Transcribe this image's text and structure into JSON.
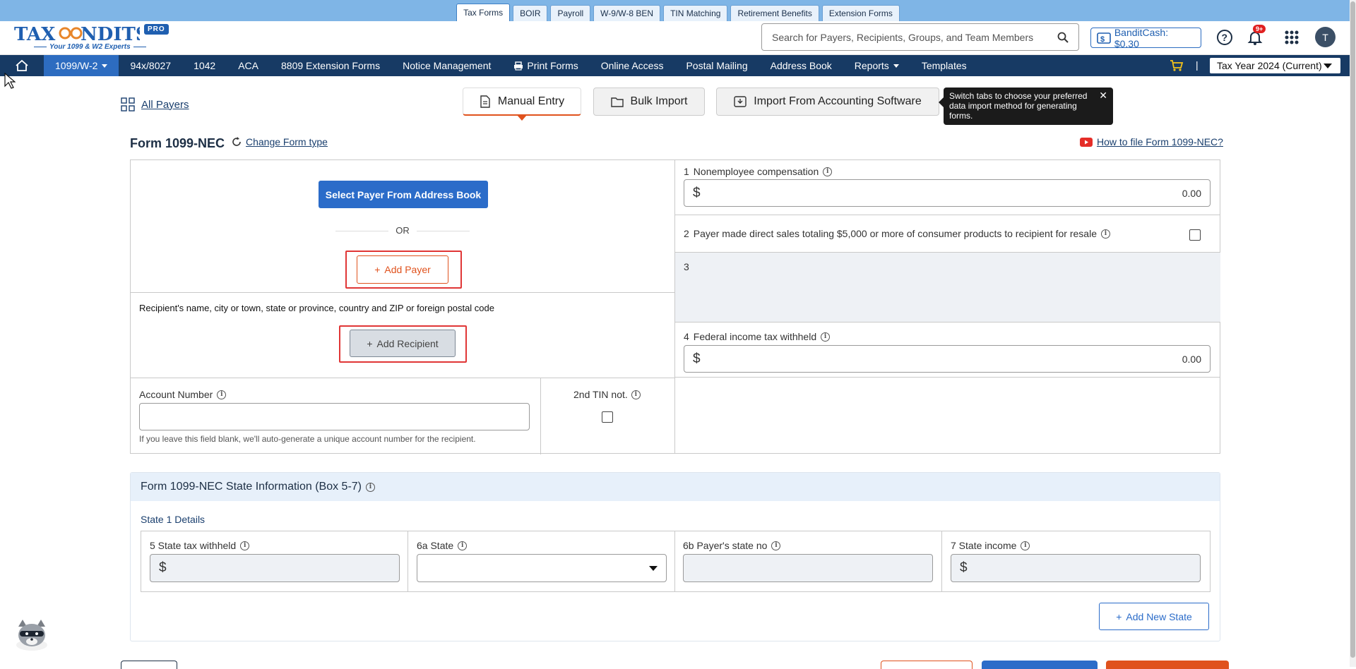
{
  "top_tabs": [
    "Tax Forms",
    "BOIR",
    "Payroll",
    "W-9/W-8 BEN",
    "TIN Matching",
    "Retirement Benefits",
    "Extension Forms"
  ],
  "logo": {
    "text": "TAXBANDITS",
    "registered": "®",
    "tagline": "Your 1099 & W2 Experts",
    "badge": "PRO"
  },
  "header": {
    "search_placeholder": "Search for Payers, Recipients, Groups, and Team Members",
    "bandit_cash": "BanditCash: $0.30",
    "notification_count": "9+",
    "avatar_initial": "T"
  },
  "nav": {
    "items": [
      "1099/W-2",
      "94x/8027",
      "1042",
      "ACA",
      "8809 Extension Forms",
      "Notice Management",
      "Print Forms",
      "Online Access",
      "Postal Mailing",
      "Address Book",
      "Reports",
      "Templates"
    ],
    "tax_year": "Tax Year 2024 (Current)"
  },
  "all_payers": "All Payers",
  "mode_tabs": [
    "Manual Entry",
    "Bulk Import",
    "Import From Accounting Software"
  ],
  "tooltip": "Switch tabs to choose your preferred data import method for generating forms.",
  "form": {
    "title": "Form 1099-NEC",
    "change_type": "Change Form type",
    "how_to": "How to file Form 1099-NEC?",
    "select_payer": "Select Payer From Address Book",
    "or": "OR",
    "add_payer": "Add Payer",
    "recipient_label": "Recipient's name, city or town, state or province, country and ZIP or foreign postal code",
    "add_recipient": "Add Recipient",
    "account_label": "Account Number",
    "account_help": "If you leave this field blank, we'll auto-generate a unique account number for the recipient.",
    "tin_label": "2nd TIN not.",
    "box1_num": "1",
    "box1_label": "Nonemployee compensation",
    "box1_value": "0.00",
    "box2_num": "2",
    "box2_label": "Payer made direct sales totaling $5,000 or more of consumer products to recipient for resale",
    "box3_num": "3",
    "box4_num": "4",
    "box4_label": "Federal income tax withheld",
    "box4_value": "0.00",
    "currency": "$"
  },
  "state": {
    "heading": "Form 1099-NEC  State Information  (Box 5-7)",
    "subheading": "State 1 Details",
    "box5": "5  State tax withheld",
    "box6a": "6a  State",
    "box6b": "6b Payer's state no",
    "box7": "7  State income",
    "add_state": "Add New State"
  }
}
